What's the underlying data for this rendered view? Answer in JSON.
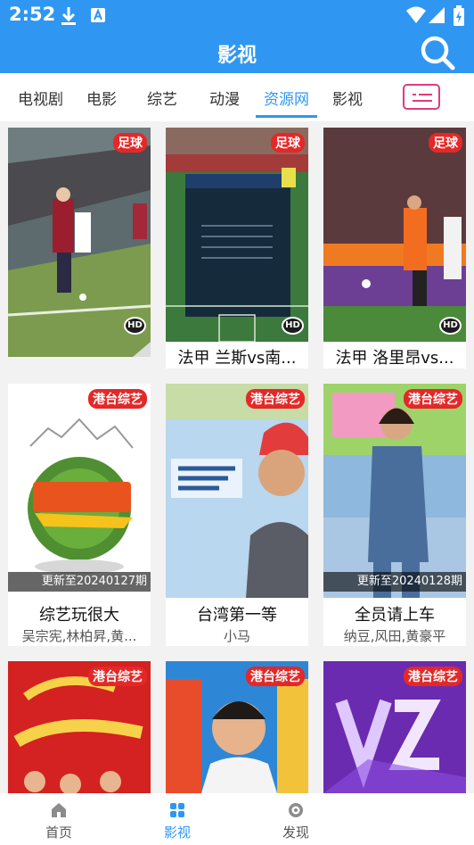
{
  "status_bar": {
    "time": "2:52"
  },
  "app_bar": {
    "title": "影视"
  },
  "tabs": [
    {
      "label": "电视剧"
    },
    {
      "label": "电影"
    },
    {
      "label": "综艺"
    },
    {
      "label": "动漫"
    },
    {
      "label": "资源网",
      "active": true
    },
    {
      "label": "影视"
    }
  ],
  "cards": [
    {
      "tag": "足球",
      "badge": "HD",
      "title": "",
      "cast": ""
    },
    {
      "tag": "足球",
      "badge": "HD",
      "title": "法甲 兰斯vs南...",
      "cast": ""
    },
    {
      "tag": "足球",
      "badge": "HD",
      "title": "法甲 洛里昂vs...",
      "cast": ""
    },
    {
      "tag": "港台综艺",
      "update": "更新至20240127期",
      "title": "综艺玩很大",
      "cast": "吴宗宪,林柏昇,黄..."
    },
    {
      "tag": "港台综艺",
      "title": "台湾第一等",
      "cast": "小马"
    },
    {
      "tag": "港台综艺",
      "update": "更新至20240128期",
      "title": "全员请上车",
      "cast": "纳豆,风田,黄豪平"
    },
    {
      "tag": "港台综艺"
    },
    {
      "tag": "港台综艺"
    },
    {
      "tag": "港台综艺"
    }
  ],
  "bottom_nav": [
    {
      "label": "首页",
      "icon": "home-icon"
    },
    {
      "label": "影视",
      "icon": "grid-icon",
      "active": true
    },
    {
      "label": "发现",
      "icon": "compass-icon"
    }
  ],
  "colors": {
    "primary": "#2f97f2",
    "tag_red": "#e42828",
    "accent_pink": "#e4397b"
  }
}
